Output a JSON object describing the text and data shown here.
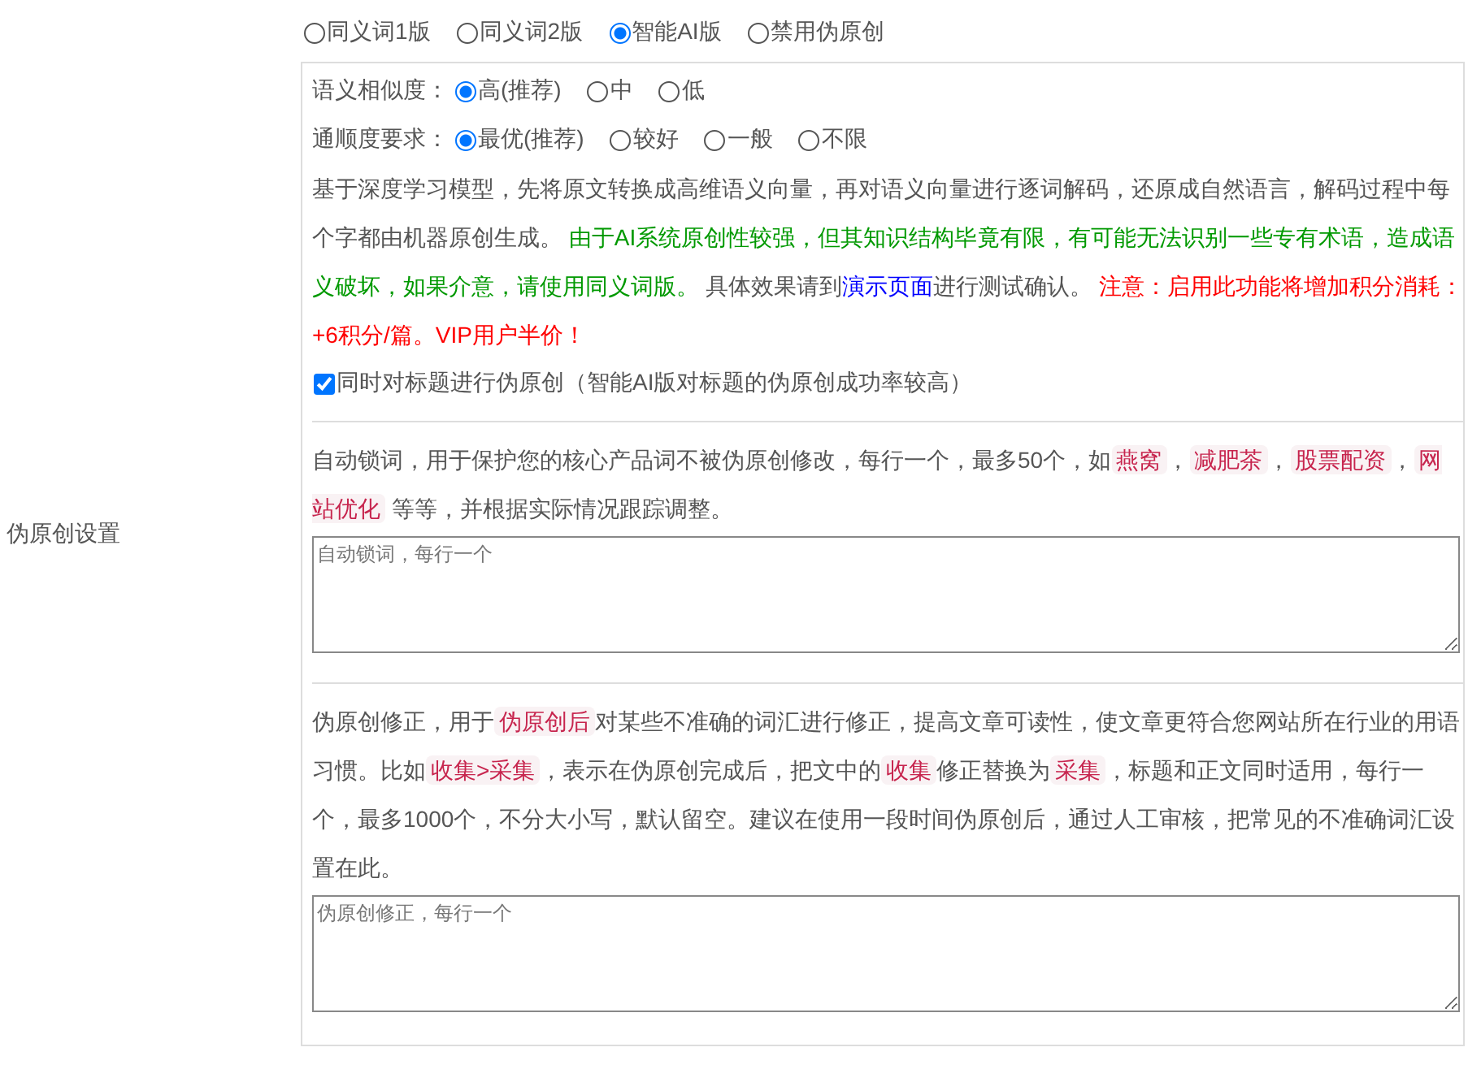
{
  "sidebar_label": "伪原创设置",
  "mode_options": [
    {
      "label": "同义词1版",
      "selected": false
    },
    {
      "label": "同义词2版",
      "selected": false
    },
    {
      "label": "智能AI版",
      "selected": true
    },
    {
      "label": "禁用伪原创",
      "selected": false
    }
  ],
  "similarity": {
    "label": "语义相似度：",
    "options": [
      {
        "label": "高(推荐)",
        "selected": true
      },
      {
        "label": "中",
        "selected": false
      },
      {
        "label": "低",
        "selected": false
      }
    ]
  },
  "fluency": {
    "label": "通顺度要求：",
    "options": [
      {
        "label": "最优(推荐)",
        "selected": true
      },
      {
        "label": "较好",
        "selected": false
      },
      {
        "label": "一般",
        "selected": false
      },
      {
        "label": "不限",
        "selected": false
      }
    ]
  },
  "ai_description": [
    {
      "kind": "plain",
      "text": "基于深度学习模型，先将原文转换成高维语义向量，再对语义向量进行逐词解码，还原成自然语言，解码过程中每个字都由机器原创生成。 "
    },
    {
      "kind": "green",
      "text": "由于AI系统原创性较强，但其知识结构毕竟有限，有可能无法识别一些专有术语，造成语义破坏，如果介意，请使用同义词版。"
    },
    {
      "kind": "plain",
      "text": " 具体效果请到"
    },
    {
      "kind": "link",
      "text": "演示页面"
    },
    {
      "kind": "plain",
      "text": "进行测试确认。 "
    },
    {
      "kind": "red",
      "text": "注意：启用此功能将增加积分消耗：+6积分/篇。VIP用户半价！"
    }
  ],
  "title_option": {
    "label": "同时对标题进行伪原创（智能AI版对标题的伪原创成功率较高）",
    "checked": true
  },
  "auto_lock": {
    "description": [
      {
        "kind": "plain",
        "text": "自动锁词，用于保护您的核心产品词不被伪原创修改，每行一个，最多50个，如"
      },
      {
        "kind": "code",
        "text": "燕窝"
      },
      {
        "kind": "plain",
        "text": "，"
      },
      {
        "kind": "code",
        "text": "减肥茶"
      },
      {
        "kind": "plain",
        "text": "，"
      },
      {
        "kind": "code",
        "text": "股票配资"
      },
      {
        "kind": "plain",
        "text": "，"
      },
      {
        "kind": "code",
        "text": "网站优化"
      },
      {
        "kind": "plain",
        "text": " 等等，并根据实际情况跟踪调整。"
      }
    ],
    "placeholder": "自动锁词，每行一个"
  },
  "correction": {
    "description": [
      {
        "kind": "plain",
        "text": "伪原创修正，用于"
      },
      {
        "kind": "code",
        "text": "伪原创后"
      },
      {
        "kind": "plain",
        "text": "对某些不准确的词汇进行修正，提高文章可读性，使文章更符合您网站所在行业的用语习惯。比如"
      },
      {
        "kind": "code",
        "text": "收集>采集"
      },
      {
        "kind": "plain",
        "text": "，表示在伪原创完成后，把文中的"
      },
      {
        "kind": "code",
        "text": "收集"
      },
      {
        "kind": "plain",
        "text": "修正替换为"
      },
      {
        "kind": "code",
        "text": "采集"
      },
      {
        "kind": "plain",
        "text": "，标题和正文同时适用，每行一个，最多1000个，不分大小写，默认留空。建议在使用一段时间伪原创后，通过人工审核，把常见的不准确词汇设置在此。"
      }
    ],
    "placeholder": "伪原创修正，每行一个"
  }
}
